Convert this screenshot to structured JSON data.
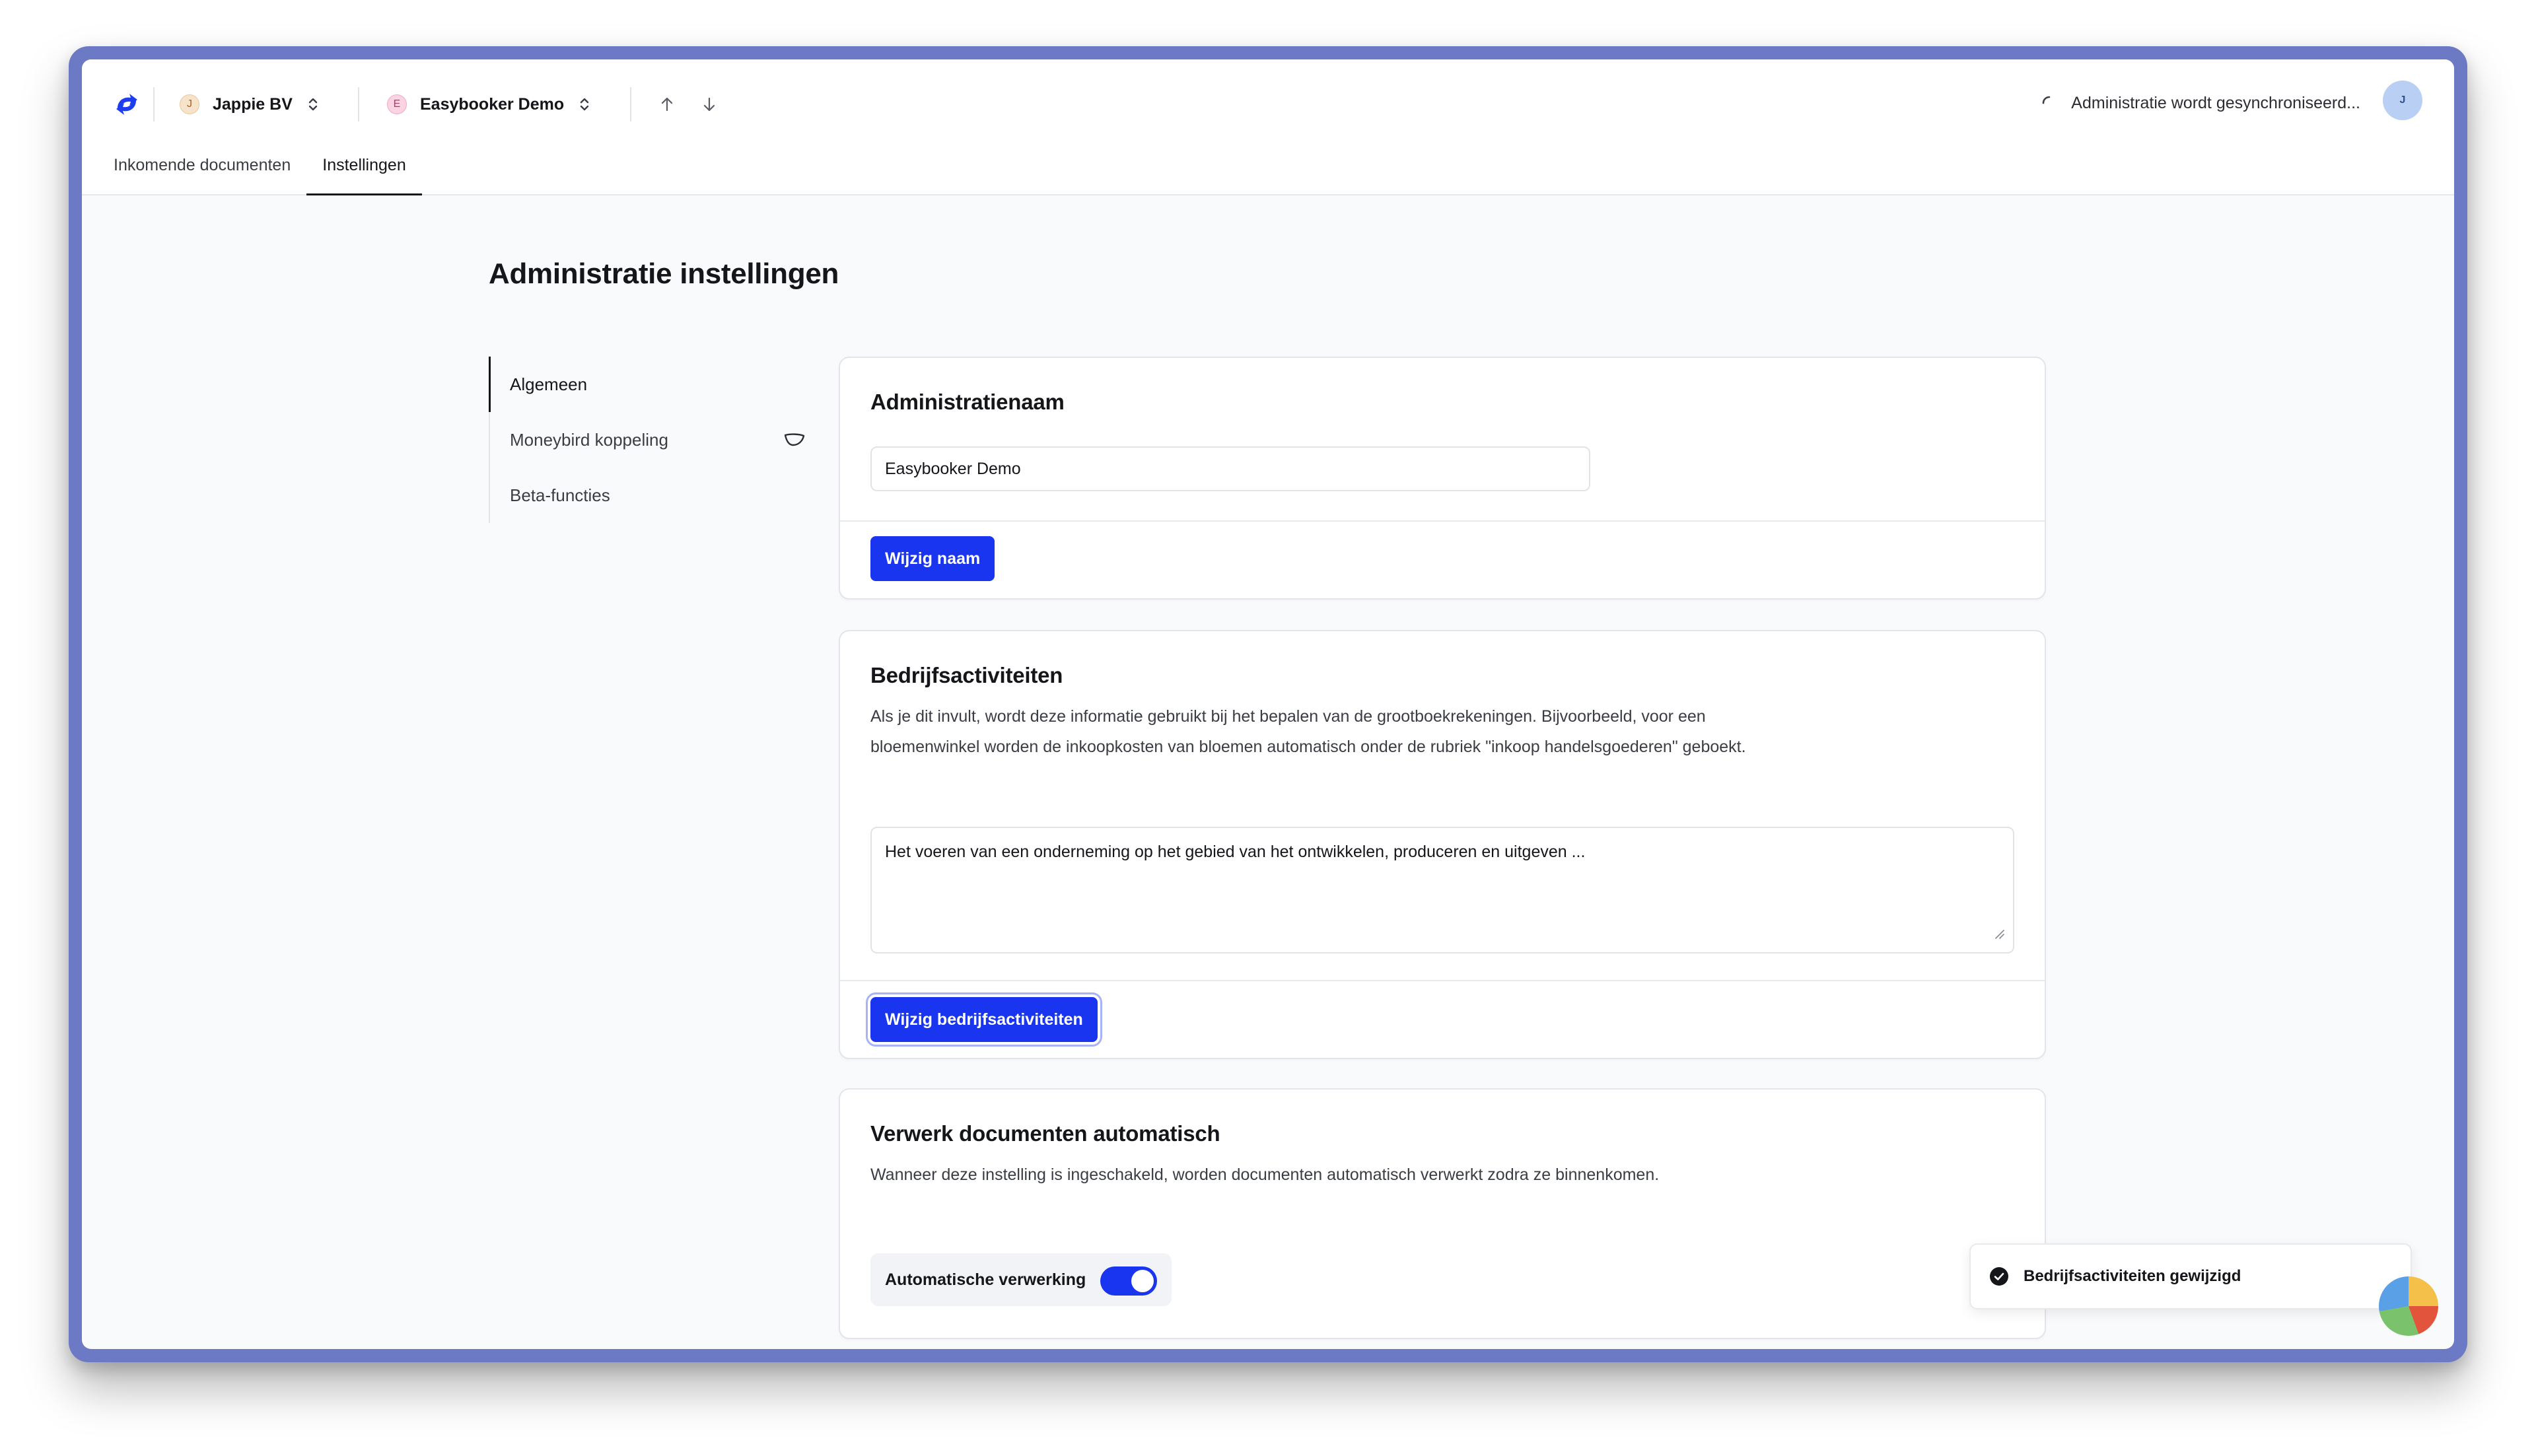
{
  "header": {
    "org": {
      "badge": "J",
      "name": "Jappie BV",
      "badge_color": "#f7e3c9"
    },
    "admin": {
      "badge": "E",
      "name": "Easybooker Demo",
      "badge_color": "#fbd3e2"
    },
    "sync_status": "Administratie wordt gesynchroniseerd...",
    "avatar": "J",
    "tabs": [
      {
        "label": "Inkomende documenten",
        "active": false
      },
      {
        "label": "Instellingen",
        "active": true
      }
    ],
    "icons": [
      "logo-icon",
      "chevron-updown-icon",
      "arrow-up-icon",
      "arrow-down-icon",
      "spinner-icon"
    ]
  },
  "page": {
    "title": "Administratie instellingen"
  },
  "sidenav": {
    "items": [
      {
        "label": "Algemeen",
        "active": true
      },
      {
        "label": "Moneybird koppeling",
        "active": false,
        "icon": "moneybird-icon"
      },
      {
        "label": "Beta-functies",
        "active": false
      }
    ]
  },
  "cards": {
    "name": {
      "title": "Administratienaam",
      "value": "Easybooker Demo",
      "button": "Wijzig naam"
    },
    "activities": {
      "title": "Bedrijfsactiviteiten",
      "description": "Als je dit invult, wordt deze informatie gebruikt bij het bepalen van de grootboekrekeningen. Bijvoorbeeld, voor een bloemenwinkel worden de inkoopkosten van bloemen automatisch onder de rubriek \"inkoop handelsgoederen\" geboekt.",
      "value": "Het voeren van een onderneming op het gebied van het ontwikkelen, produceren en uitgeven ...",
      "button": "Wijzig bedrijfsactiviteiten"
    },
    "auto": {
      "title": "Verwerk documenten automatisch",
      "description": "Wanneer deze instelling is ingeschakeld, worden documenten automatisch verwerkt zodra ze binnenkomen.",
      "toggle_label": "Automatische verwerking",
      "toggle_on": true
    }
  },
  "toast": {
    "message": "Bedrijfsactiviteiten gewijzigd"
  },
  "colors": {
    "accent": "#1935f0",
    "frame": "#6c79c4"
  }
}
